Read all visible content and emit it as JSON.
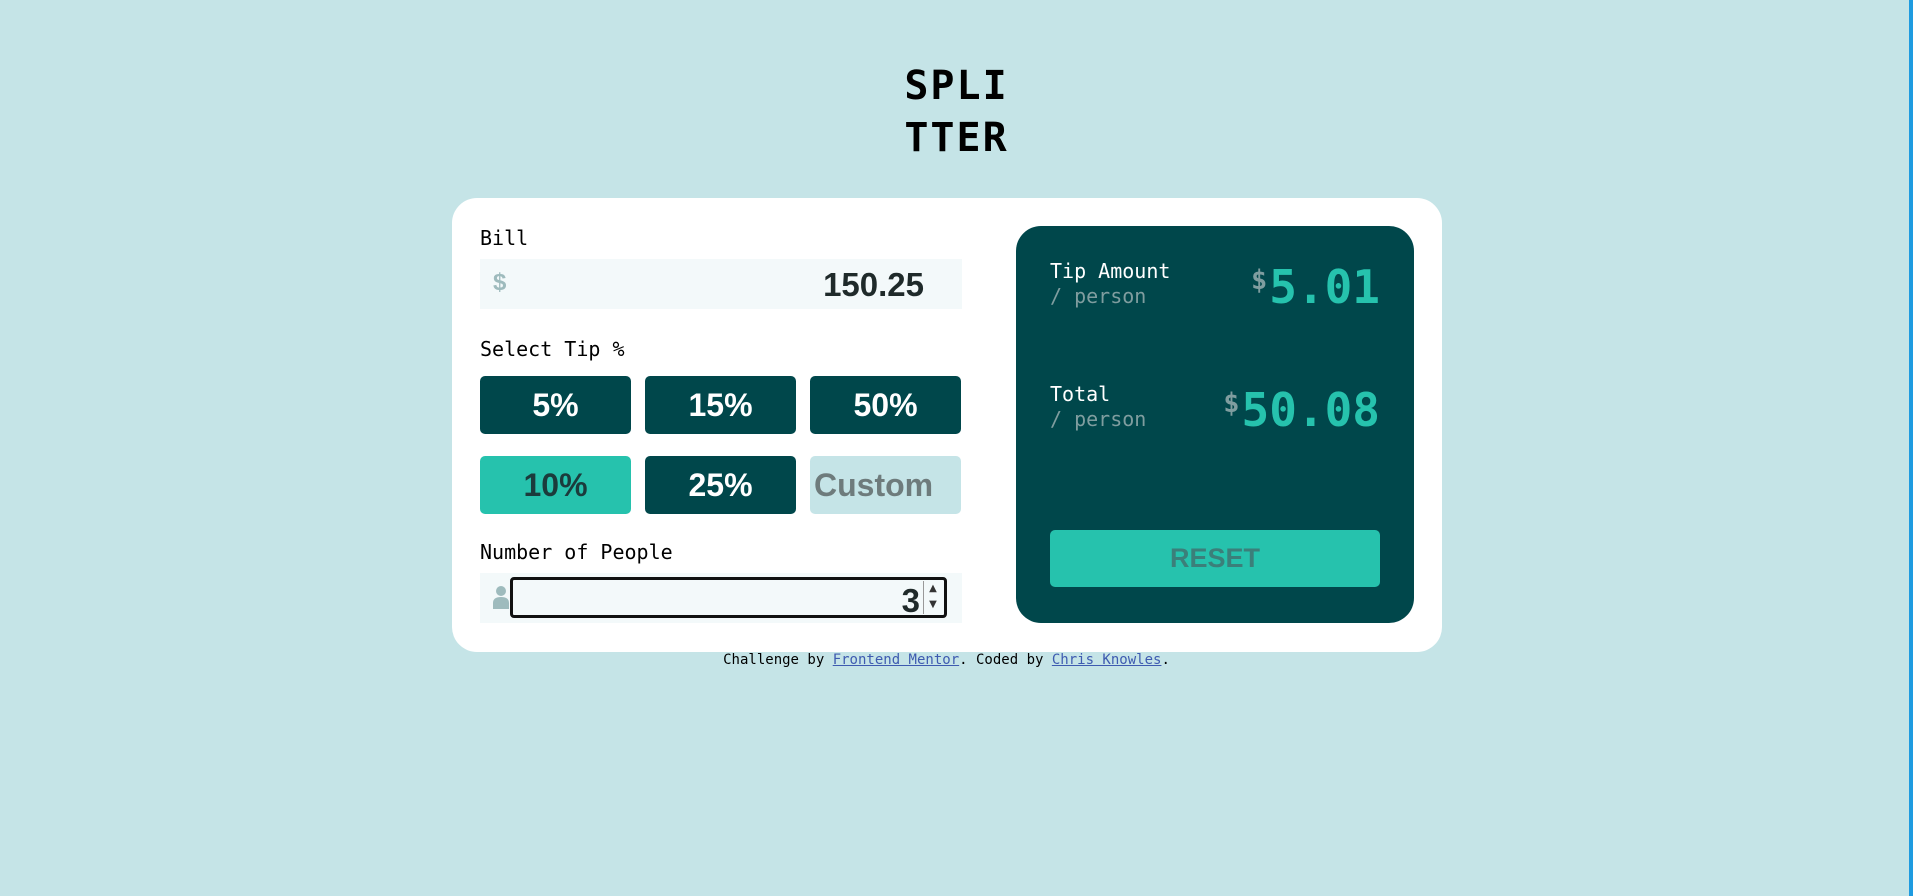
{
  "app": {
    "logo_line1": "SPLI",
    "logo_line2": "TTER"
  },
  "bill": {
    "label": "Bill",
    "currency_symbol": "$",
    "value": "150.25"
  },
  "tip": {
    "label": "Select Tip %",
    "options": [
      "5%",
      "15%",
      "50%",
      "10%",
      "25%"
    ],
    "selected": "10%",
    "custom_placeholder": "Custom"
  },
  "people": {
    "label": "Number of People",
    "icon": "person-icon",
    "value": "3",
    "spinner_up": "▲",
    "spinner_down": "▼"
  },
  "results": {
    "tip_label": "Tip Amount",
    "tip_sub": "/ person",
    "tip_currency": "$",
    "tip_value": "5.01",
    "total_label": "Total",
    "total_sub": "/ person",
    "total_currency": "$",
    "total_value": "50.08",
    "reset_label": "RESET"
  },
  "footer": {
    "prefix": "Challenge by ",
    "link1": "Frontend Mentor",
    "middle": ". Coded by ",
    "link2": "Chris Knowles",
    "suffix": "."
  },
  "colors": {
    "page_bg": "#c5e4e7",
    "dark_cyan": "#00474b",
    "accent": "#26c2ad",
    "input_bg": "#f3f9fa",
    "muted": "#7f9d9f",
    "scrollbar_edge": "#1e9be0"
  }
}
